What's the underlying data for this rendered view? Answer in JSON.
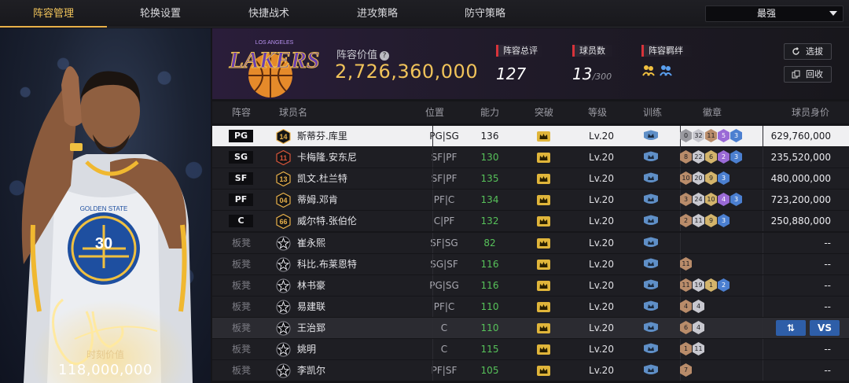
{
  "nav": {
    "tabs": [
      "阵容管理",
      "轮换设置",
      "快捷战术",
      "进攻策略",
      "防守策略"
    ],
    "active_tab": 0,
    "dropdown_value": "最强"
  },
  "player_card": {
    "moment_label": "时刻价值",
    "moment_value": "118,000,000",
    "jersey_number": "30",
    "jersey_text": "GOLDEN STATE"
  },
  "team": {
    "logo_text": "LAKERS",
    "logo_subtext": "LOS ANGELES",
    "value_label": "阵容价值",
    "value": "2,726,360,000",
    "stats": [
      {
        "label": "阵容总评",
        "value": "127",
        "suffix": ""
      },
      {
        "label": "球员数",
        "value": "13",
        "suffix": "/300"
      },
      {
        "label": "阵容羁绊",
        "value": "",
        "suffix": ""
      }
    ],
    "buttons": {
      "select": "选拔",
      "recycle": "回收"
    }
  },
  "table": {
    "headers": [
      "阵容",
      "球员名",
      "位置",
      "能力",
      "突破",
      "等级",
      "训练",
      "徽章",
      "球员身价"
    ],
    "action_labels": {
      "swap": "⇅",
      "vs": "VS"
    },
    "rows": [
      {
        "slot": "PG",
        "starter": true,
        "jersey": "14",
        "jersey_style": "gold",
        "name": "斯蒂芬.库里",
        "pos": "PG|SG",
        "ability": "136",
        "level": "Lv.20",
        "badges": [
          [
            "0",
            "grey"
          ],
          [
            "32",
            "silver"
          ],
          [
            "11",
            "bronze"
          ],
          [
            "5",
            "purple"
          ],
          [
            "3",
            "blue"
          ]
        ],
        "value": "629,760,000",
        "state": "selected"
      },
      {
        "slot": "SG",
        "starter": true,
        "jersey": "11",
        "jersey_style": "red",
        "name": "卡梅隆.安东尼",
        "pos": "SF|PF",
        "ability": "130",
        "level": "Lv.20",
        "badges": [
          [
            "8",
            "bronze"
          ],
          [
            "22",
            "silver"
          ],
          [
            "6",
            "gold"
          ],
          [
            "2",
            "purple"
          ],
          [
            "3",
            "blue"
          ]
        ],
        "value": "235,520,000",
        "state": ""
      },
      {
        "slot": "SF",
        "starter": true,
        "jersey": "13",
        "jersey_style": "gold",
        "name": "凯文.杜兰特",
        "pos": "SF|PF",
        "ability": "135",
        "level": "Lv.20",
        "badges": [
          [
            "10",
            "bronze"
          ],
          [
            "20",
            "silver"
          ],
          [
            "9",
            "gold"
          ],
          [
            "3",
            "blue"
          ]
        ],
        "value": "480,000,000",
        "state": ""
      },
      {
        "slot": "PF",
        "starter": true,
        "jersey": "04",
        "jersey_style": "gold",
        "name": "蒂姆.邓肯",
        "pos": "PF|C",
        "ability": "134",
        "level": "Lv.20",
        "badges": [
          [
            "3",
            "bronze"
          ],
          [
            "24",
            "silver"
          ],
          [
            "10",
            "gold"
          ],
          [
            "4",
            "purple"
          ],
          [
            "3",
            "blue"
          ]
        ],
        "value": "723,200,000",
        "state": ""
      },
      {
        "slot": "C",
        "starter": true,
        "jersey": "66",
        "jersey_style": "gold",
        "name": "威尔特.张伯伦",
        "pos": "C|PF",
        "ability": "132",
        "level": "Lv.20",
        "badges": [
          [
            "2",
            "bronze"
          ],
          [
            "11",
            "silver"
          ],
          [
            "9",
            "gold"
          ],
          [
            "3",
            "blue"
          ]
        ],
        "value": "250,880,000",
        "state": ""
      },
      {
        "slot": "板凳",
        "starter": false,
        "jersey": "",
        "jersey_style": "star",
        "name": "崔永熙",
        "pos": "SF|SG",
        "ability": "82",
        "level": "Lv.20",
        "badges": [],
        "value": "--",
        "state": ""
      },
      {
        "slot": "板凳",
        "starter": false,
        "jersey": "",
        "jersey_style": "star",
        "name": "科比.布莱恩特",
        "pos": "SG|SF",
        "ability": "116",
        "level": "Lv.20",
        "badges": [
          [
            "11",
            "bronze"
          ]
        ],
        "value": "--",
        "state": ""
      },
      {
        "slot": "板凳",
        "starter": false,
        "jersey": "",
        "jersey_style": "star",
        "name": "林书豪",
        "pos": "PG|SG",
        "ability": "116",
        "level": "Lv.20",
        "badges": [
          [
            "11",
            "bronze"
          ],
          [
            "19",
            "silver"
          ],
          [
            "1",
            "gold"
          ],
          [
            "2",
            "blue"
          ]
        ],
        "value": "--",
        "state": ""
      },
      {
        "slot": "板凳",
        "starter": false,
        "jersey": "",
        "jersey_style": "star",
        "name": "易建联",
        "pos": "PF|C",
        "ability": "110",
        "level": "Lv.20",
        "badges": [
          [
            "4",
            "bronze"
          ],
          [
            "4",
            "silver"
          ]
        ],
        "value": "--",
        "state": ""
      },
      {
        "slot": "板凳",
        "starter": false,
        "jersey": "",
        "jersey_style": "star",
        "name": "王治郅",
        "pos": "C",
        "ability": "110",
        "level": "Lv.20",
        "badges": [
          [
            "6",
            "bronze"
          ],
          [
            "4",
            "silver"
          ]
        ],
        "value": "",
        "state": "focused"
      },
      {
        "slot": "板凳",
        "starter": false,
        "jersey": "",
        "jersey_style": "star",
        "name": "姚明",
        "pos": "C",
        "ability": "115",
        "level": "Lv.20",
        "badges": [
          [
            "1",
            "bronze"
          ],
          [
            "11",
            "silver"
          ]
        ],
        "value": "--",
        "state": ""
      },
      {
        "slot": "板凳",
        "starter": false,
        "jersey": "",
        "jersey_style": "star",
        "name": "李凯尔",
        "pos": "PF|SF",
        "ability": "105",
        "level": "Lv.20",
        "badges": [
          [
            "7",
            "bronze"
          ]
        ],
        "value": "--",
        "state": ""
      }
    ]
  },
  "colors": {
    "accent_gold": "#f0c35a",
    "ability_green": "#57c25a",
    "stat_red": "#d8333a",
    "action_blue": "#2e5ea8"
  }
}
